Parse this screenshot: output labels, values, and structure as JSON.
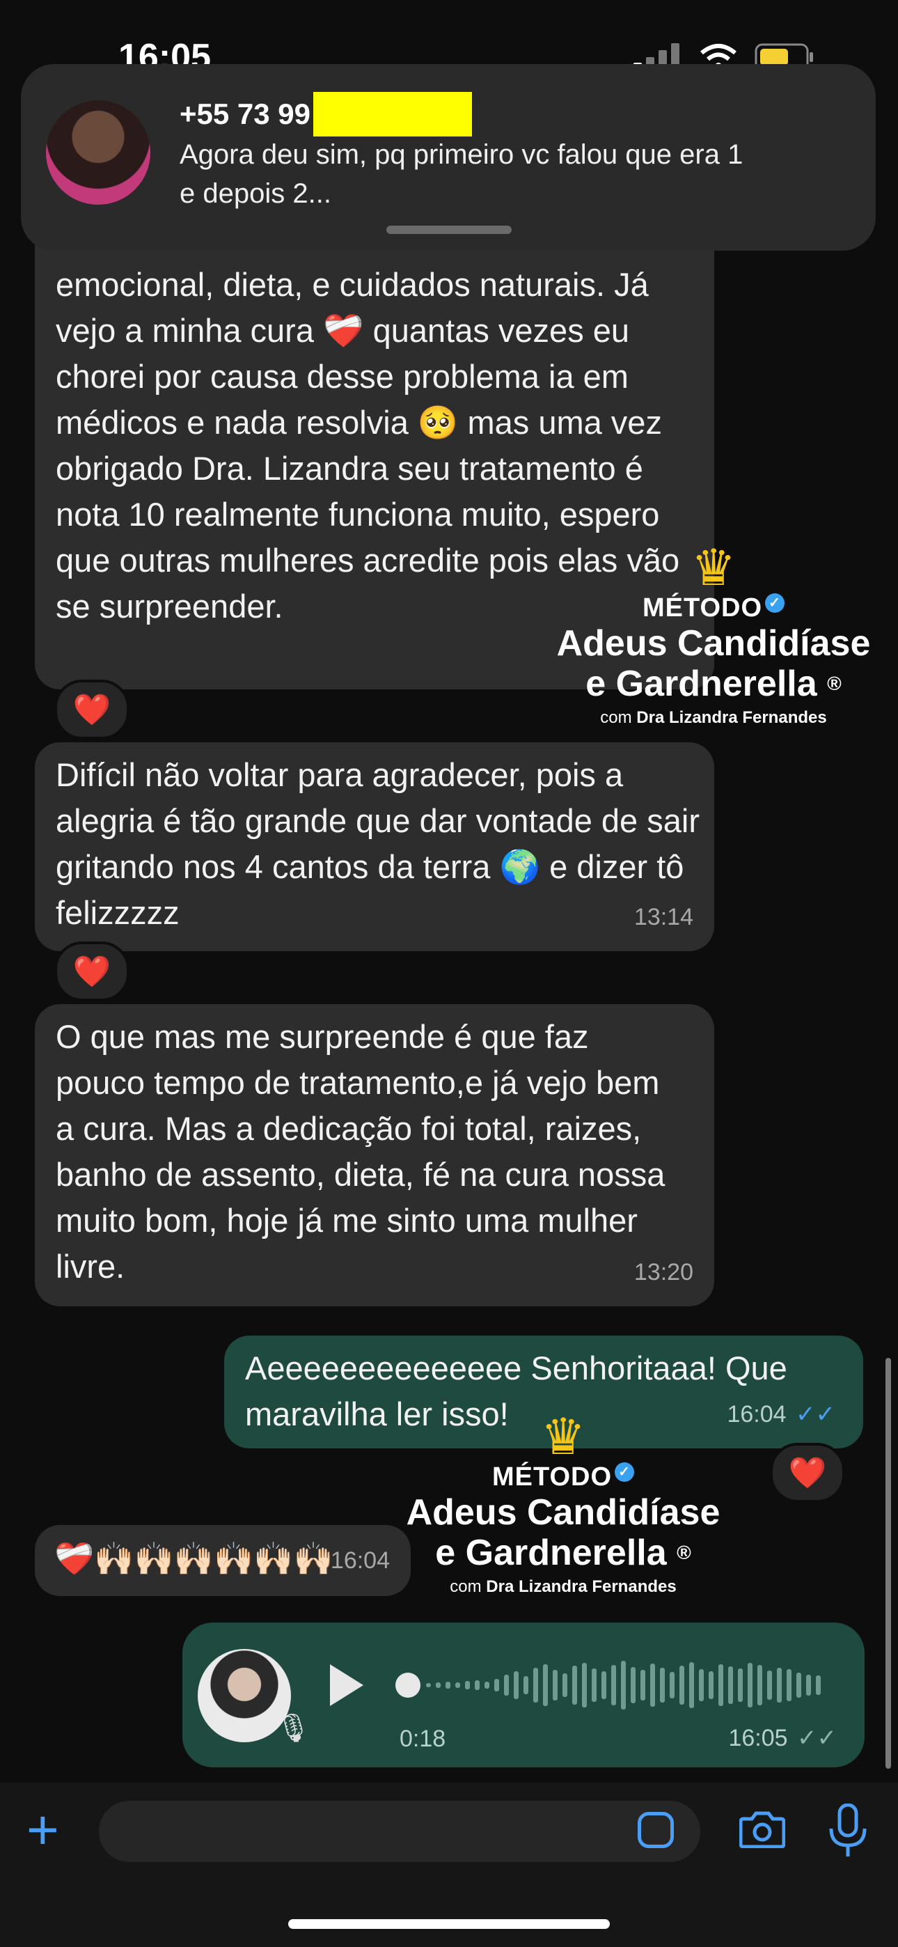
{
  "status": {
    "time": "16:05"
  },
  "notification": {
    "sender": "+55 73 99",
    "message": "Agora deu sim, pq primeiro vc falou que era 1 e depois 2..."
  },
  "messages": [
    {
      "text": "emocional, dieta, e cuidados naturais. Já vejo a minha cura ❤️‍🩹 quantas vezes eu chorei por causa desse problema ia em médicos e nada resolvia 🥺 mas uma vez obrigado Dra. Lizandra seu tratamento é nota 10 realmente funciona muito, espero que outras mulheres acredite pois elas vão se surpreender.",
      "reaction": "❤️"
    },
    {
      "text": "Difícil não voltar para agradecer, pois a alegria é tão grande que dar vontade de sair gritando nos 4 cantos da terra 🌍 e dizer tô felizzzzz",
      "time": "13:14",
      "reaction": "❤️"
    },
    {
      "text": "O que mas me surpreende é que faz pouco tempo de tratamento,e já vejo bem a cura. Mas a dedicação foi total, raizes, banho de assento, dieta, fé na cura nossa muito bom, hoje já me sinto uma mulher livre.",
      "time": "13:20"
    },
    {
      "text": "Aeeeeeeeeeeeeee Senhoritaaa! Que maravilha ler isso!",
      "time": "16:04",
      "reaction": "❤️"
    },
    {
      "text": "❤️‍🩹🙌🏻🙌🏻🙌🏻🙌🏻🙌🏻🙌🏻",
      "time": "16:04"
    }
  ],
  "voice": {
    "duration": "0:18",
    "time": "16:05"
  },
  "watermark": {
    "metodo": "MÉTODO",
    "line1": "Adeus Candidíase",
    "line2": "e Gardnerella",
    "registered": "®",
    "sub_prefix": "com",
    "sub_name": "Dra Lizandra Fernandes"
  },
  "icons": {
    "plus": "plus-icon",
    "sticker": "sticker-icon",
    "camera": "camera-icon",
    "mic": "mic-icon",
    "play": "play-icon",
    "crown": "crown-icon",
    "verified": "verified-badge-icon",
    "read": "double-check-icon",
    "signal": "signal-icon",
    "wifi": "wifi-icon",
    "battery": "battery-icon"
  },
  "colors": {
    "accent": "#4a9ef5",
    "outgoing": "#1e4a40",
    "incoming": "#2d2d2d",
    "crown": "#f5c518",
    "redaction": "#ffff00"
  }
}
